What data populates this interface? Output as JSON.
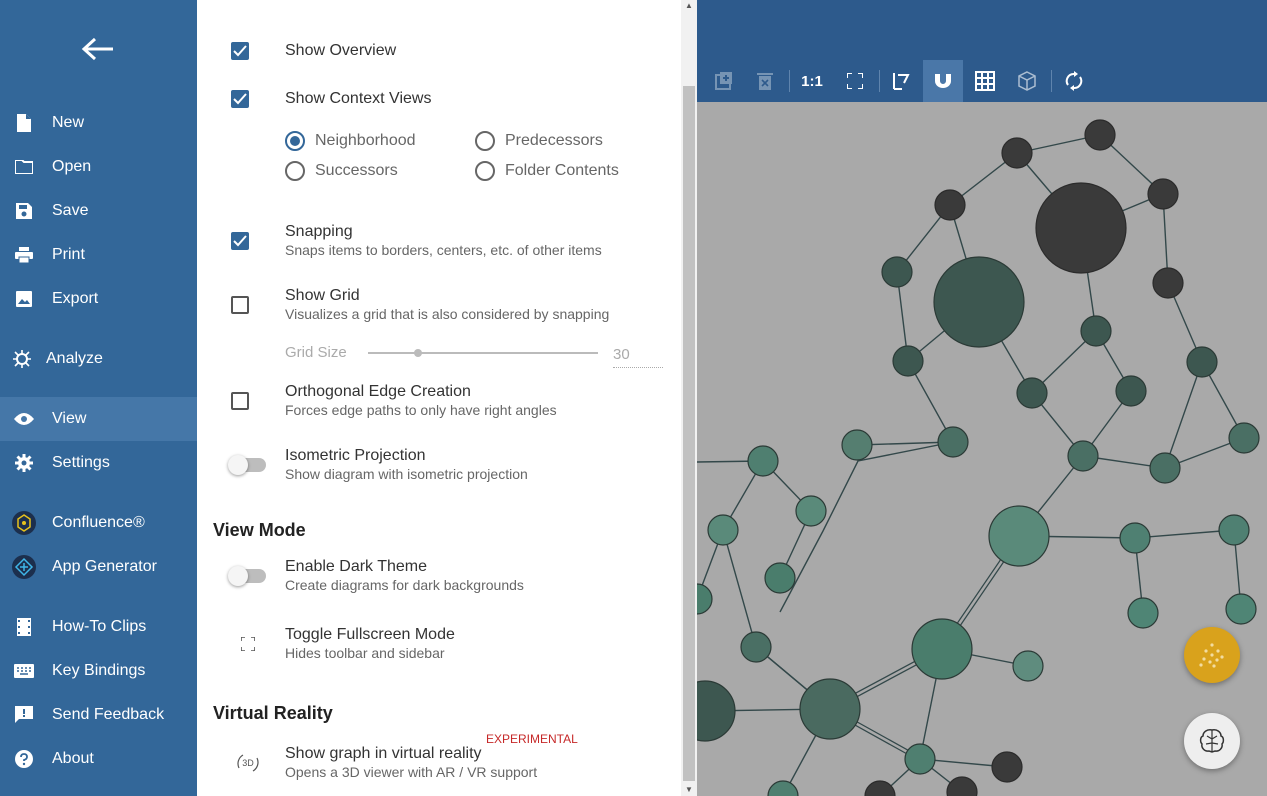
{
  "nav": {
    "items": [
      {
        "label": "New",
        "icon": "file-icon"
      },
      {
        "label": "Open",
        "icon": "folder-icon"
      },
      {
        "label": "Save",
        "icon": "save-icon"
      },
      {
        "label": "Print",
        "icon": "print-icon"
      },
      {
        "label": "Export",
        "icon": "image-icon"
      },
      {
        "label": "Analyze",
        "icon": "analyze-icon"
      },
      {
        "label": "View",
        "icon": "eye-icon",
        "active": true
      },
      {
        "label": "Settings",
        "icon": "gear-icon"
      },
      {
        "label": "Confluence®",
        "icon": "confluence-icon"
      },
      {
        "label": "App Generator",
        "icon": "app-generator-icon"
      },
      {
        "label": "How-To Clips",
        "icon": "film-icon"
      },
      {
        "label": "Key Bindings",
        "icon": "keyboard-icon"
      },
      {
        "label": "Send Feedback",
        "icon": "feedback-icon"
      },
      {
        "label": "About",
        "icon": "help-icon"
      }
    ]
  },
  "panel": {
    "show_overview": {
      "label": "Show Overview",
      "checked": true
    },
    "show_context_views": {
      "label": "Show Context Views",
      "checked": true
    },
    "context_options": {
      "neighborhood": "Neighborhood",
      "predecessors": "Predecessors",
      "successors": "Successors",
      "folder_contents": "Folder Contents",
      "selected": "Neighborhood"
    },
    "snapping": {
      "label": "Snapping",
      "desc": "Snaps items to borders, centers, etc. of other items",
      "checked": true
    },
    "show_grid": {
      "label": "Show Grid",
      "desc": "Visualizes a grid that is also considered by snapping",
      "checked": false
    },
    "grid_size": {
      "label": "Grid Size",
      "value": "30"
    },
    "orthogonal": {
      "label": "Orthogonal Edge Creation",
      "desc": "Forces edge paths to only have right angles",
      "checked": false
    },
    "isometric": {
      "label": "Isometric Projection",
      "desc": "Show diagram with isometric projection",
      "on": false
    },
    "view_mode_heading": "View Mode",
    "dark_theme": {
      "label": "Enable Dark Theme",
      "desc": "Create diagrams for dark backgrounds",
      "on": false
    },
    "fullscreen": {
      "label": "Toggle Fullscreen Mode",
      "desc": "Hides toolbar and sidebar"
    },
    "vr_heading": "Virtual Reality",
    "vr": {
      "label": "Show graph in virtual reality",
      "desc": "Opens a 3D viewer with AR / VR support",
      "badge": "EXPERIMENTAL",
      "icon_text": "3D"
    }
  },
  "toolbar": {
    "zoom_original": "1:1"
  },
  "colors": {
    "nav_bg": "#336799",
    "appbar_bg": "#2d5a8c",
    "canvas_bg": "#a9a9a9",
    "accent": "#336799",
    "fab_orange": "#d9a21c",
    "node_dark": "#3a3a3a",
    "node_green": "#4f7f70"
  }
}
